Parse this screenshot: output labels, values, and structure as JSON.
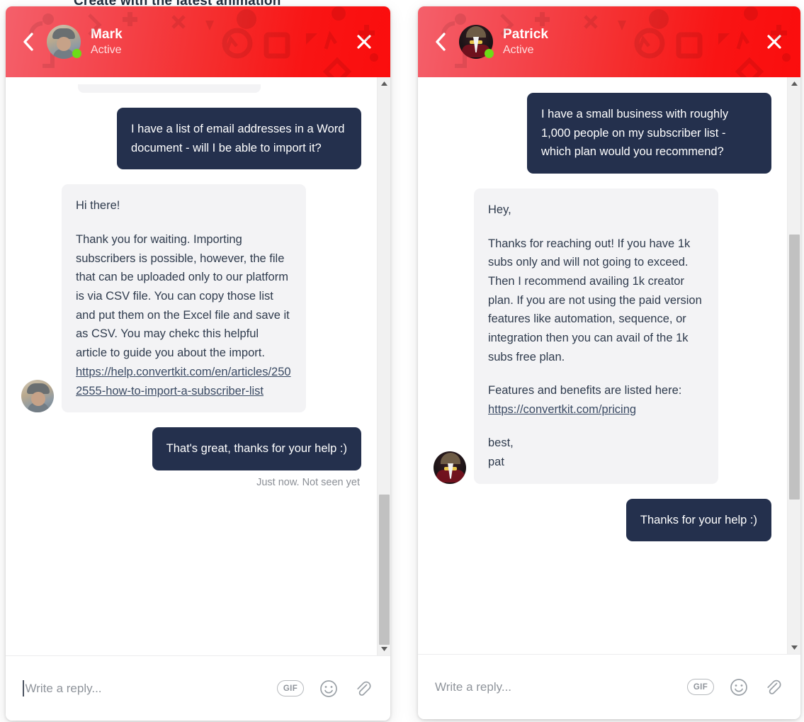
{
  "background": {
    "cut_off_text": "Create with the latest animation"
  },
  "theme": {
    "header_gradient_start": "#f4606b",
    "header_gradient_end": "#fb0d0d",
    "outgoing_bubble": "#24304d",
    "incoming_bubble": "#f3f3f5",
    "status_dot": "#6ddc17",
    "link_color": "#3a4a63"
  },
  "panels": [
    {
      "id": "mark",
      "header": {
        "back_label": "Back",
        "name": "Mark",
        "status": "Active",
        "close_label": "Close"
      },
      "messages": [
        {
          "side": "out",
          "paragraphs": [
            "I have a list of email addresses in a Word document - will I be able to import it?"
          ]
        },
        {
          "side": "in",
          "avatar": "mark-avatar",
          "paragraphs": [
            "Hi there!",
            "Thank you for waiting. Importing subscribers is possible, however, the file that can be uploaded only to our platform is via CSV file. You can copy those list and put them on the Excel file and save it as CSV. You may chekc this helpful article to guide you about the import."
          ],
          "link": "https://help.convertkit.com/en/articles/2502555-how-to-import-a-subscriber-list"
        },
        {
          "side": "out",
          "paragraphs": [
            "That's great, thanks for your help :)"
          ],
          "meta": "Just now. Not seen yet"
        }
      ],
      "composer": {
        "placeholder": "Write a reply...",
        "value": "",
        "gif_label": "GIF",
        "emoji_label": "Emoji",
        "attach_label": "Attach file"
      },
      "scrollbar": {
        "thumb_top_pct": 70,
        "thumb_height_pct": 26
      }
    },
    {
      "id": "patrick",
      "header": {
        "back_label": "Back",
        "name": "Patrick",
        "status": "Active",
        "close_label": "Close"
      },
      "messages": [
        {
          "side": "out",
          "paragraphs": [
            "I have a small business with roughly 1,000 people on my subscriber list - which plan would you recommend?"
          ]
        },
        {
          "side": "in",
          "avatar": "patrick-avatar",
          "paragraphs": [
            "Hey,",
            "Thanks for reaching out! If you have 1k subs only and will not going to exceed. Then I recommend availing 1k creator plan. If you are not using the paid version features like automation, sequence, or integration then you can avail of the 1k subs free plan.",
            "Features and benefits are listed here:"
          ],
          "link": "https://convertkit.com/pricing",
          "signature": [
            "best,",
            "pat"
          ]
        },
        {
          "side": "out",
          "paragraphs": [
            "Thanks for your help :)"
          ]
        }
      ],
      "composer": {
        "placeholder": "Write a reply...",
        "value": "",
        "gif_label": "GIF",
        "emoji_label": "Emoji",
        "attach_label": "Attach file"
      },
      "scrollbar": {
        "thumb_top_pct": 25,
        "thumb_height_pct": 46
      }
    }
  ]
}
